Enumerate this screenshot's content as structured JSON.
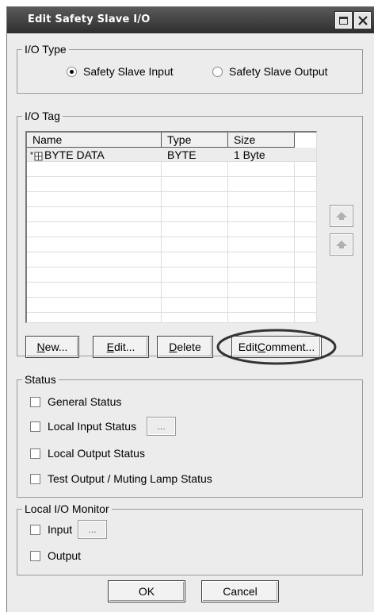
{
  "window": {
    "title": "Edit Safety Slave I/O"
  },
  "io_type": {
    "label": "I/O Type",
    "options": [
      {
        "label": "Safety Slave Input",
        "selected": true
      },
      {
        "label": "Safety Slave Output",
        "selected": false
      }
    ]
  },
  "io_tag": {
    "label": "I/O Tag",
    "columns": [
      "Name",
      "Type",
      "Size"
    ],
    "rows": [
      {
        "icon": "tag-icon",
        "name": "BYTE DATA",
        "type": "BYTE",
        "size": "1 Byte"
      }
    ],
    "buttons": {
      "new_prefix": "N",
      "new_rest": "ew...",
      "edit_prefix": "E",
      "edit_rest": "dit...",
      "delete_prefix": "D",
      "delete_rest": "elete",
      "comment_pre": "Edit ",
      "comment_u": "C",
      "comment_rest": "omment..."
    }
  },
  "status": {
    "label": "Status",
    "items": [
      {
        "label": "General Status",
        "checked": false
      },
      {
        "label": "Local Input Status",
        "checked": false,
        "has_button": true,
        "button_label": "..."
      },
      {
        "label": "Local Output Status",
        "checked": false
      },
      {
        "label": "Test Output / Muting Lamp Status",
        "checked": false
      }
    ]
  },
  "monitor": {
    "label": "Local I/O Monitor",
    "items": [
      {
        "label": "Input",
        "checked": false,
        "button_label": "..."
      },
      {
        "label": "Output",
        "checked": false
      }
    ]
  },
  "footer": {
    "ok_label": "OK",
    "cancel_label": "Cancel"
  },
  "colors": {
    "titlebar": "#3c3c3c",
    "dialog_bg": "#ececec",
    "highlight_ellipse": "#333333"
  }
}
